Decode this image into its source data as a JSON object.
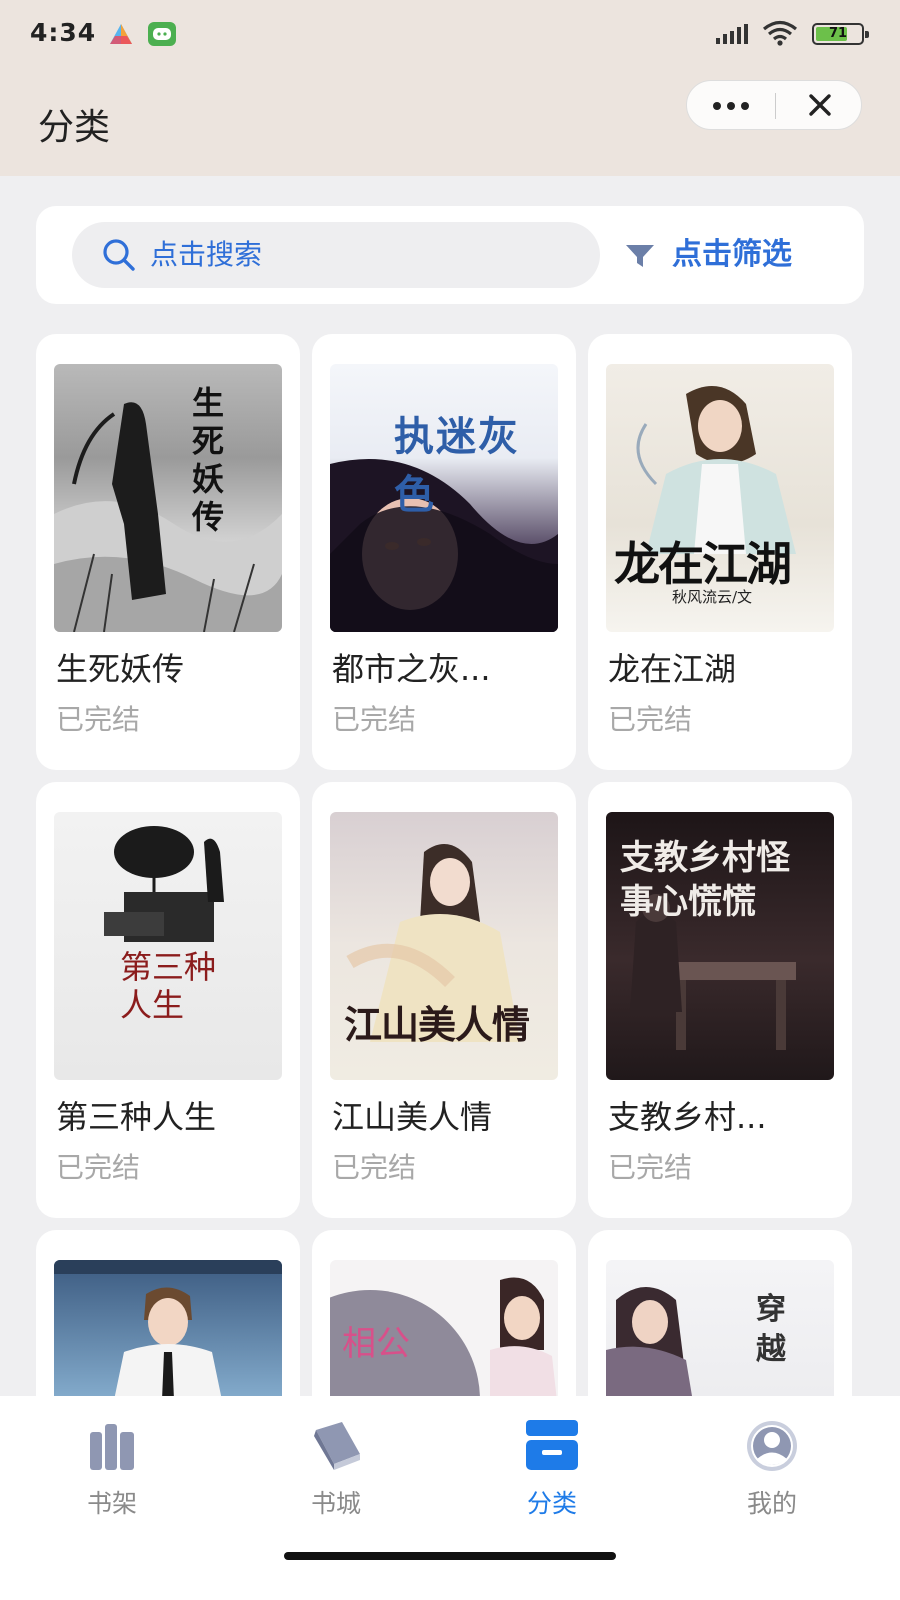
{
  "status_bar": {
    "time": "4:34",
    "battery": "71",
    "battery_level": 0.71
  },
  "header": {
    "title": "分类"
  },
  "search": {
    "placeholder_text": "点击搜索",
    "filter_label": "点击筛选"
  },
  "books": [
    {
      "title": "生死妖传",
      "status": "已完结",
      "cover_text": "生死妖传"
    },
    {
      "title": "都市之灰...",
      "status": "已完结",
      "cover_text": "执迷灰色"
    },
    {
      "title": "龙在江湖",
      "status": "已完结",
      "cover_text": "龙在江湖",
      "cover_subtext": "秋风流云/文"
    },
    {
      "title": "第三种人生",
      "status": "已完结",
      "cover_text": "第三种人生"
    },
    {
      "title": "江山美人情",
      "status": "已完结",
      "cover_text": "江山美人情"
    },
    {
      "title": "支教乡村...",
      "status": "已完结",
      "cover_text": "支教乡村怪事心慌慌"
    },
    {
      "title": "",
      "status": ""
    },
    {
      "title": "",
      "status": "",
      "cover_text": "相公"
    },
    {
      "title": "",
      "status": "",
      "cover_text": "穿越"
    }
  ],
  "tabs": [
    {
      "label": "书架",
      "icon": "bookshelf-icon"
    },
    {
      "label": "书城",
      "icon": "book-icon"
    },
    {
      "label": "分类",
      "icon": "category-icon",
      "active": true
    },
    {
      "label": "我的",
      "icon": "user-icon"
    }
  ],
  "colors": {
    "accent": "#1e7be8",
    "link": "#2f6fd8",
    "header_bg": "#ece4de",
    "page_bg": "#efeff1"
  }
}
